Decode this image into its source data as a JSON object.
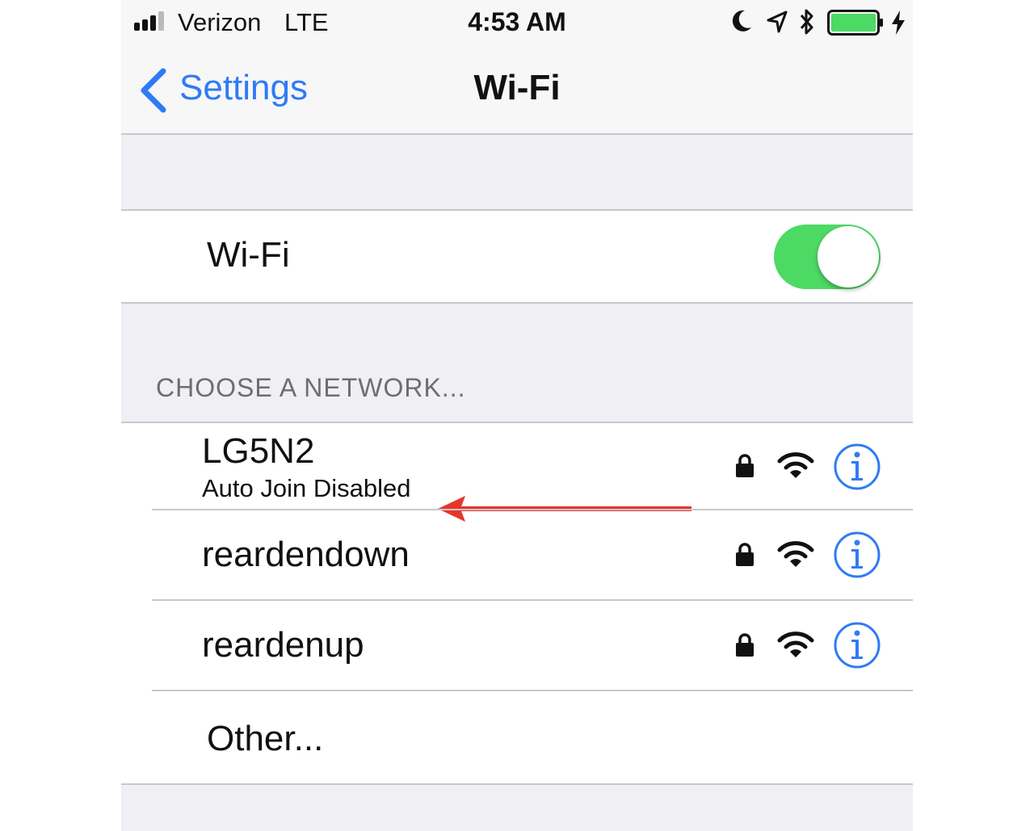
{
  "status_bar": {
    "carrier": "Verizon",
    "network_type": "LTE",
    "time": "4:53 AM",
    "icons": [
      "signal-bars-icon",
      "moon-icon",
      "location-arrow-icon",
      "bluetooth-icon",
      "battery-icon",
      "charging-bolt-icon"
    ],
    "battery_color": "#4cd964"
  },
  "nav": {
    "back_label": "Settings",
    "title": "Wi-Fi",
    "accent_color": "#2f7bf5"
  },
  "wifi_toggle": {
    "label": "Wi-Fi",
    "on": true,
    "on_color": "#4cd964"
  },
  "networks_section": {
    "header": "CHOOSE A NETWORK...",
    "networks": [
      {
        "name": "LG5N2",
        "subtitle": "Auto Join Disabled",
        "secured": true
      },
      {
        "name": "reardendown",
        "secured": true
      },
      {
        "name": "reardenup",
        "secured": true
      }
    ],
    "other_label": "Other..."
  },
  "annotation": {
    "arrow_color": "#e8352b",
    "points_to": "Auto Join Disabled"
  }
}
